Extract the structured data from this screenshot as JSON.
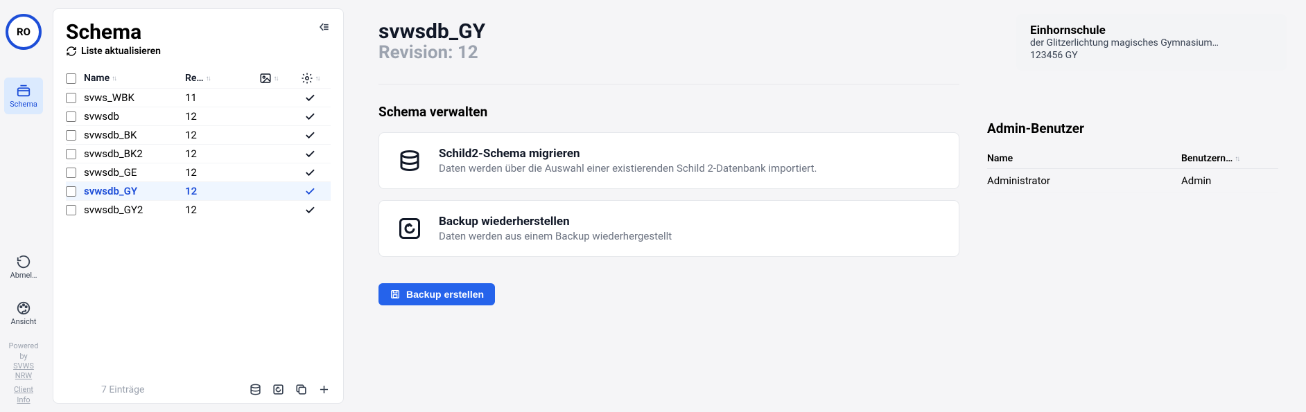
{
  "avatar": "RO",
  "nav": {
    "schema": "Schema",
    "logout": "Abmel…",
    "view": "Ansicht"
  },
  "powered": {
    "l1": "Powered",
    "l2": "by",
    "l3": "SVWS",
    "l4": "NRW",
    "client": "Client",
    "info": "Info"
  },
  "panel": {
    "title": "Schema",
    "refresh": "Liste aktualisieren",
    "cols": {
      "name": "Name",
      "rev": "Re…"
    },
    "rows": [
      {
        "name": "svws_WBK",
        "rev": "11",
        "ok": true,
        "selected": false
      },
      {
        "name": "svwsdb",
        "rev": "12",
        "ok": true,
        "selected": false
      },
      {
        "name": "svwsdb_BK",
        "rev": "12",
        "ok": true,
        "selected": false
      },
      {
        "name": "svwsdb_BK2",
        "rev": "12",
        "ok": true,
        "selected": false
      },
      {
        "name": "svwsdb_GE",
        "rev": "12",
        "ok": true,
        "selected": false
      },
      {
        "name": "svwsdb_GY",
        "rev": "12",
        "ok": true,
        "selected": true
      },
      {
        "name": "svwsdb_GY2",
        "rev": "12",
        "ok": true,
        "selected": false
      }
    ],
    "count": "7 Einträge"
  },
  "detail": {
    "name": "svwsdb_GY",
    "revision_label": "Revision: 12",
    "section": "Schema verwalten",
    "card1": {
      "title": "Schild2-Schema migrieren",
      "desc": "Daten werden über die Auswahl einer existierenden Schild 2-Datenbank importiert."
    },
    "card2": {
      "title": "Backup wiederherstellen",
      "desc": "Daten werden aus einem Backup wiederhergestellt"
    },
    "backup_btn": "Backup erstellen"
  },
  "school": {
    "name": "Einhornschule",
    "sub": "der Glitzerlichtung magisches Gymnasium…",
    "code": "123456 GY"
  },
  "admin": {
    "title": "Admin-Benutzer",
    "cols": {
      "name": "Name",
      "user": "Benutzern…"
    },
    "rows": [
      {
        "name": "Administrator",
        "user": "Admin"
      }
    ]
  }
}
